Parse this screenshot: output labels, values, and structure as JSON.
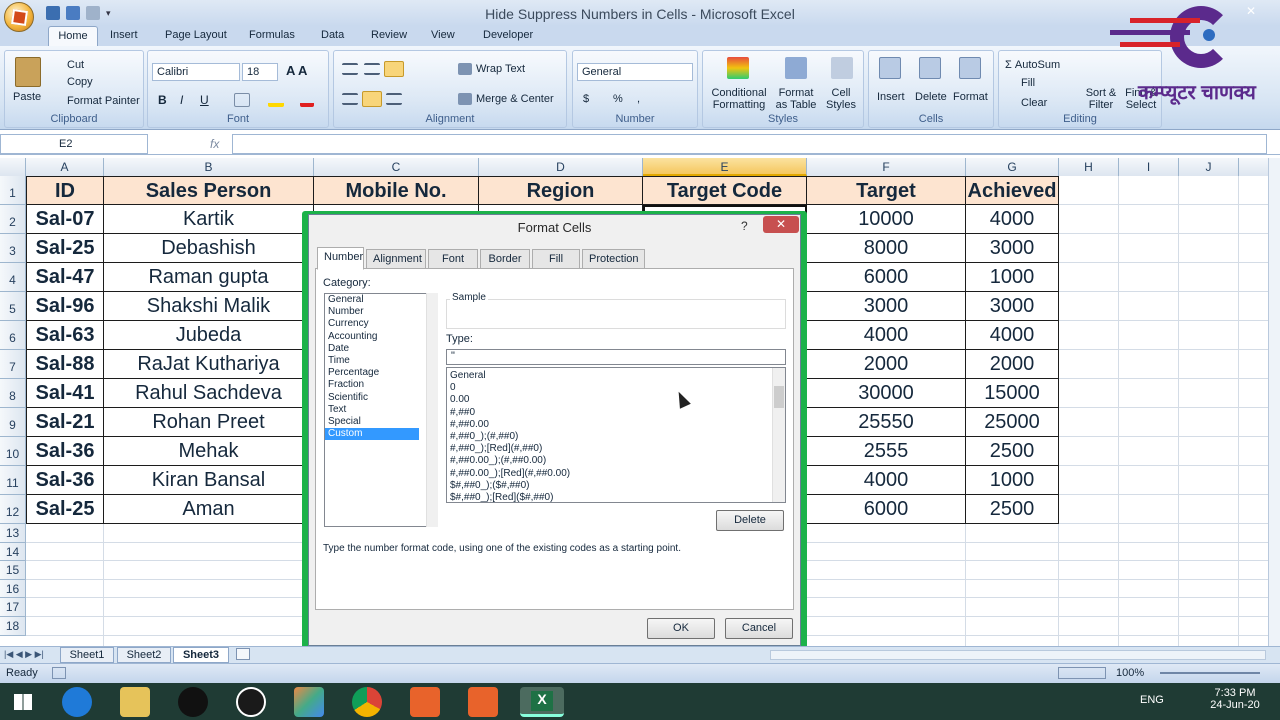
{
  "window": {
    "title": "Hide Suppress Numbers in Cells - Microsoft Excel"
  },
  "tabs": [
    "Home",
    "Insert",
    "Page Layout",
    "Formulas",
    "Data",
    "Review",
    "View",
    "Developer"
  ],
  "ribbon": {
    "clipboard": {
      "label": "Clipboard",
      "paste": "Paste",
      "cut": "Cut",
      "copy": "Copy",
      "format_painter": "Format Painter"
    },
    "font": {
      "label": "Font",
      "name": "Calibri",
      "size": "18",
      "bold": "B",
      "italic": "I",
      "underline": "U"
    },
    "alignment": {
      "label": "Alignment",
      "wrap": "Wrap Text",
      "merge": "Merge & Center"
    },
    "number": {
      "label": "Number",
      "format": "General",
      "currency": "$",
      "percent": "%",
      "comma": ","
    },
    "styles": {
      "label": "Styles",
      "cond": "Conditional Formatting",
      "table": "Format as Table",
      "cell": "Cell Styles"
    },
    "cells": {
      "label": "Cells",
      "insert": "Insert",
      "delete": "Delete",
      "format": "Format"
    },
    "editing": {
      "label": "Editing",
      "autosum": "AutoSum",
      "fill": "Fill",
      "clear": "Clear",
      "sort": "Sort & Filter",
      "find": "Find & Select"
    }
  },
  "brand": {
    "text": "कम्प्यूटर चाणक्य",
    "color": "#5b2a8c"
  },
  "formula_bar": {
    "name_box": "E2",
    "fx": "fx",
    "value": ""
  },
  "columns": [
    "A",
    "B",
    "C",
    "D",
    "E",
    "F",
    "G",
    "H",
    "I",
    "J"
  ],
  "rows": [
    "1",
    "2",
    "3",
    "4",
    "5",
    "6",
    "7",
    "8",
    "9",
    "10",
    "11",
    "12",
    "13",
    "14",
    "15",
    "16",
    "17",
    "18"
  ],
  "table": {
    "headers": [
      "ID",
      "Sales Person",
      "Mobile No.",
      "Region",
      "Target Code",
      "Target",
      "Achieved"
    ],
    "ids": [
      "Sal-07",
      "Sal-25",
      "Sal-47",
      "Sal-96",
      "Sal-63",
      "Sal-88",
      "Sal-41",
      "Sal-21",
      "Sal-36",
      "Sal-36",
      "Sal-25"
    ],
    "persons": [
      "Kartik",
      "Debashish",
      "Raman gupta",
      "Shakshi Malik",
      "Jubeda",
      "RaJat  Kuthariya",
      "Rahul Sachdeva",
      "Rohan Preet",
      "Mehak",
      "Kiran Bansal",
      "Aman"
    ],
    "targets": [
      "10000",
      "8000",
      "6000",
      "3000",
      "4000",
      "2000",
      "30000",
      "25550",
      "2555",
      "4000",
      "6000"
    ],
    "achieved": [
      "4000",
      "3000",
      "1000",
      "3000",
      "4000",
      "2000",
      "15000",
      "25000",
      "2500",
      "1000",
      "2500"
    ]
  },
  "dialog": {
    "title": "Format Cells",
    "help": "?",
    "tabs": [
      "Number",
      "Alignment",
      "Font",
      "Border",
      "Fill",
      "Protection"
    ],
    "category_label": "Category:",
    "categories": [
      "General",
      "Number",
      "Currency",
      "Accounting",
      "Date",
      "Time",
      "Percentage",
      "Fraction",
      "Scientific",
      "Text",
      "Special",
      "Custom"
    ],
    "selected_category": "Custom",
    "sample_label": "Sample",
    "type_label": "Type:",
    "type_value": "\"",
    "formats": [
      "General",
      "0",
      "0.00",
      "#,##0",
      "#,##0.00",
      "#,##0_);(#,##0)",
      "#,##0_);[Red](#,##0)",
      "#,##0.00_);(#,##0.00)",
      "#,##0.00_);[Red](#,##0.00)",
      "$#,##0_);($#,##0)",
      "$#,##0_);[Red]($#,##0)"
    ],
    "delete": "Delete",
    "hint": "Type the number format code, using one of the existing codes as a starting point.",
    "ok": "OK",
    "cancel": "Cancel"
  },
  "sheets": [
    "Sheet1",
    "Sheet2",
    "Sheet3"
  ],
  "active_sheet": "Sheet3",
  "status": {
    "ready": "Ready",
    "zoom": "100%"
  },
  "taskbar": {
    "lang": "ENG",
    "time": "7:33 PM",
    "date": "24-Jun-20"
  }
}
